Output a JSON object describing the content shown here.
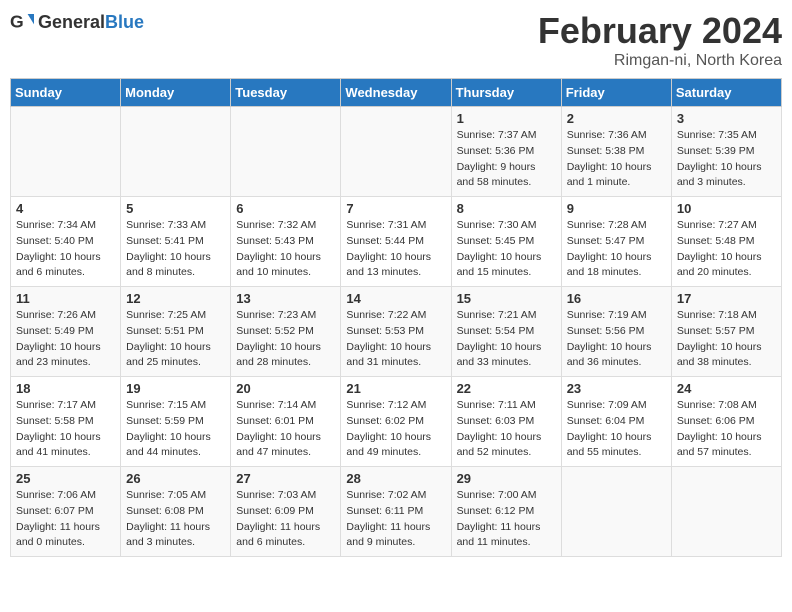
{
  "logo": {
    "general": "General",
    "blue": "Blue"
  },
  "title": "February 2024",
  "subtitle": "Rimgan-ni, North Korea",
  "days_header": [
    "Sunday",
    "Monday",
    "Tuesday",
    "Wednesday",
    "Thursday",
    "Friday",
    "Saturday"
  ],
  "weeks": [
    [
      {
        "day": "",
        "sunrise": "",
        "sunset": "",
        "daylight": ""
      },
      {
        "day": "",
        "sunrise": "",
        "sunset": "",
        "daylight": ""
      },
      {
        "day": "",
        "sunrise": "",
        "sunset": "",
        "daylight": ""
      },
      {
        "day": "",
        "sunrise": "",
        "sunset": "",
        "daylight": ""
      },
      {
        "day": "1",
        "sunrise": "Sunrise: 7:37 AM",
        "sunset": "Sunset: 5:36 PM",
        "daylight": "Daylight: 9 hours and 58 minutes."
      },
      {
        "day": "2",
        "sunrise": "Sunrise: 7:36 AM",
        "sunset": "Sunset: 5:38 PM",
        "daylight": "Daylight: 10 hours and 1 minute."
      },
      {
        "day": "3",
        "sunrise": "Sunrise: 7:35 AM",
        "sunset": "Sunset: 5:39 PM",
        "daylight": "Daylight: 10 hours and 3 minutes."
      }
    ],
    [
      {
        "day": "4",
        "sunrise": "Sunrise: 7:34 AM",
        "sunset": "Sunset: 5:40 PM",
        "daylight": "Daylight: 10 hours and 6 minutes."
      },
      {
        "day": "5",
        "sunrise": "Sunrise: 7:33 AM",
        "sunset": "Sunset: 5:41 PM",
        "daylight": "Daylight: 10 hours and 8 minutes."
      },
      {
        "day": "6",
        "sunrise": "Sunrise: 7:32 AM",
        "sunset": "Sunset: 5:43 PM",
        "daylight": "Daylight: 10 hours and 10 minutes."
      },
      {
        "day": "7",
        "sunrise": "Sunrise: 7:31 AM",
        "sunset": "Sunset: 5:44 PM",
        "daylight": "Daylight: 10 hours and 13 minutes."
      },
      {
        "day": "8",
        "sunrise": "Sunrise: 7:30 AM",
        "sunset": "Sunset: 5:45 PM",
        "daylight": "Daylight: 10 hours and 15 minutes."
      },
      {
        "day": "9",
        "sunrise": "Sunrise: 7:28 AM",
        "sunset": "Sunset: 5:47 PM",
        "daylight": "Daylight: 10 hours and 18 minutes."
      },
      {
        "day": "10",
        "sunrise": "Sunrise: 7:27 AM",
        "sunset": "Sunset: 5:48 PM",
        "daylight": "Daylight: 10 hours and 20 minutes."
      }
    ],
    [
      {
        "day": "11",
        "sunrise": "Sunrise: 7:26 AM",
        "sunset": "Sunset: 5:49 PM",
        "daylight": "Daylight: 10 hours and 23 minutes."
      },
      {
        "day": "12",
        "sunrise": "Sunrise: 7:25 AM",
        "sunset": "Sunset: 5:51 PM",
        "daylight": "Daylight: 10 hours and 25 minutes."
      },
      {
        "day": "13",
        "sunrise": "Sunrise: 7:23 AM",
        "sunset": "Sunset: 5:52 PM",
        "daylight": "Daylight: 10 hours and 28 minutes."
      },
      {
        "day": "14",
        "sunrise": "Sunrise: 7:22 AM",
        "sunset": "Sunset: 5:53 PM",
        "daylight": "Daylight: 10 hours and 31 minutes."
      },
      {
        "day": "15",
        "sunrise": "Sunrise: 7:21 AM",
        "sunset": "Sunset: 5:54 PM",
        "daylight": "Daylight: 10 hours and 33 minutes."
      },
      {
        "day": "16",
        "sunrise": "Sunrise: 7:19 AM",
        "sunset": "Sunset: 5:56 PM",
        "daylight": "Daylight: 10 hours and 36 minutes."
      },
      {
        "day": "17",
        "sunrise": "Sunrise: 7:18 AM",
        "sunset": "Sunset: 5:57 PM",
        "daylight": "Daylight: 10 hours and 38 minutes."
      }
    ],
    [
      {
        "day": "18",
        "sunrise": "Sunrise: 7:17 AM",
        "sunset": "Sunset: 5:58 PM",
        "daylight": "Daylight: 10 hours and 41 minutes."
      },
      {
        "day": "19",
        "sunrise": "Sunrise: 7:15 AM",
        "sunset": "Sunset: 5:59 PM",
        "daylight": "Daylight: 10 hours and 44 minutes."
      },
      {
        "day": "20",
        "sunrise": "Sunrise: 7:14 AM",
        "sunset": "Sunset: 6:01 PM",
        "daylight": "Daylight: 10 hours and 47 minutes."
      },
      {
        "day": "21",
        "sunrise": "Sunrise: 7:12 AM",
        "sunset": "Sunset: 6:02 PM",
        "daylight": "Daylight: 10 hours and 49 minutes."
      },
      {
        "day": "22",
        "sunrise": "Sunrise: 7:11 AM",
        "sunset": "Sunset: 6:03 PM",
        "daylight": "Daylight: 10 hours and 52 minutes."
      },
      {
        "day": "23",
        "sunrise": "Sunrise: 7:09 AM",
        "sunset": "Sunset: 6:04 PM",
        "daylight": "Daylight: 10 hours and 55 minutes."
      },
      {
        "day": "24",
        "sunrise": "Sunrise: 7:08 AM",
        "sunset": "Sunset: 6:06 PM",
        "daylight": "Daylight: 10 hours and 57 minutes."
      }
    ],
    [
      {
        "day": "25",
        "sunrise": "Sunrise: 7:06 AM",
        "sunset": "Sunset: 6:07 PM",
        "daylight": "Daylight: 11 hours and 0 minutes."
      },
      {
        "day": "26",
        "sunrise": "Sunrise: 7:05 AM",
        "sunset": "Sunset: 6:08 PM",
        "daylight": "Daylight: 11 hours and 3 minutes."
      },
      {
        "day": "27",
        "sunrise": "Sunrise: 7:03 AM",
        "sunset": "Sunset: 6:09 PM",
        "daylight": "Daylight: 11 hours and 6 minutes."
      },
      {
        "day": "28",
        "sunrise": "Sunrise: 7:02 AM",
        "sunset": "Sunset: 6:11 PM",
        "daylight": "Daylight: 11 hours and 9 minutes."
      },
      {
        "day": "29",
        "sunrise": "Sunrise: 7:00 AM",
        "sunset": "Sunset: 6:12 PM",
        "daylight": "Daylight: 11 hours and 11 minutes."
      },
      {
        "day": "",
        "sunrise": "",
        "sunset": "",
        "daylight": ""
      },
      {
        "day": "",
        "sunrise": "",
        "sunset": "",
        "daylight": ""
      }
    ]
  ]
}
